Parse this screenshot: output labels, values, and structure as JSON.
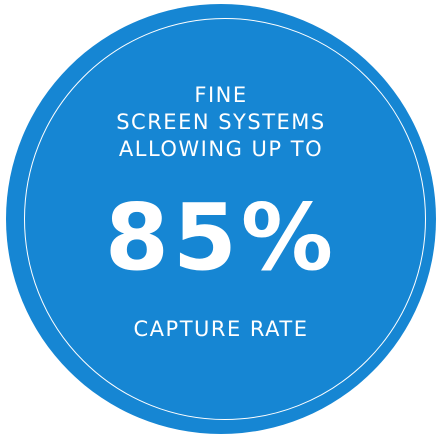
{
  "badge": {
    "background_color": "#1686d3",
    "ring_color": "#ffffff",
    "headline_lines": [
      "FINE",
      "SCREEN SYSTEMS",
      "ALLOWING UP TO"
    ],
    "value": "85%",
    "caption": "CAPTURE RATE"
  }
}
